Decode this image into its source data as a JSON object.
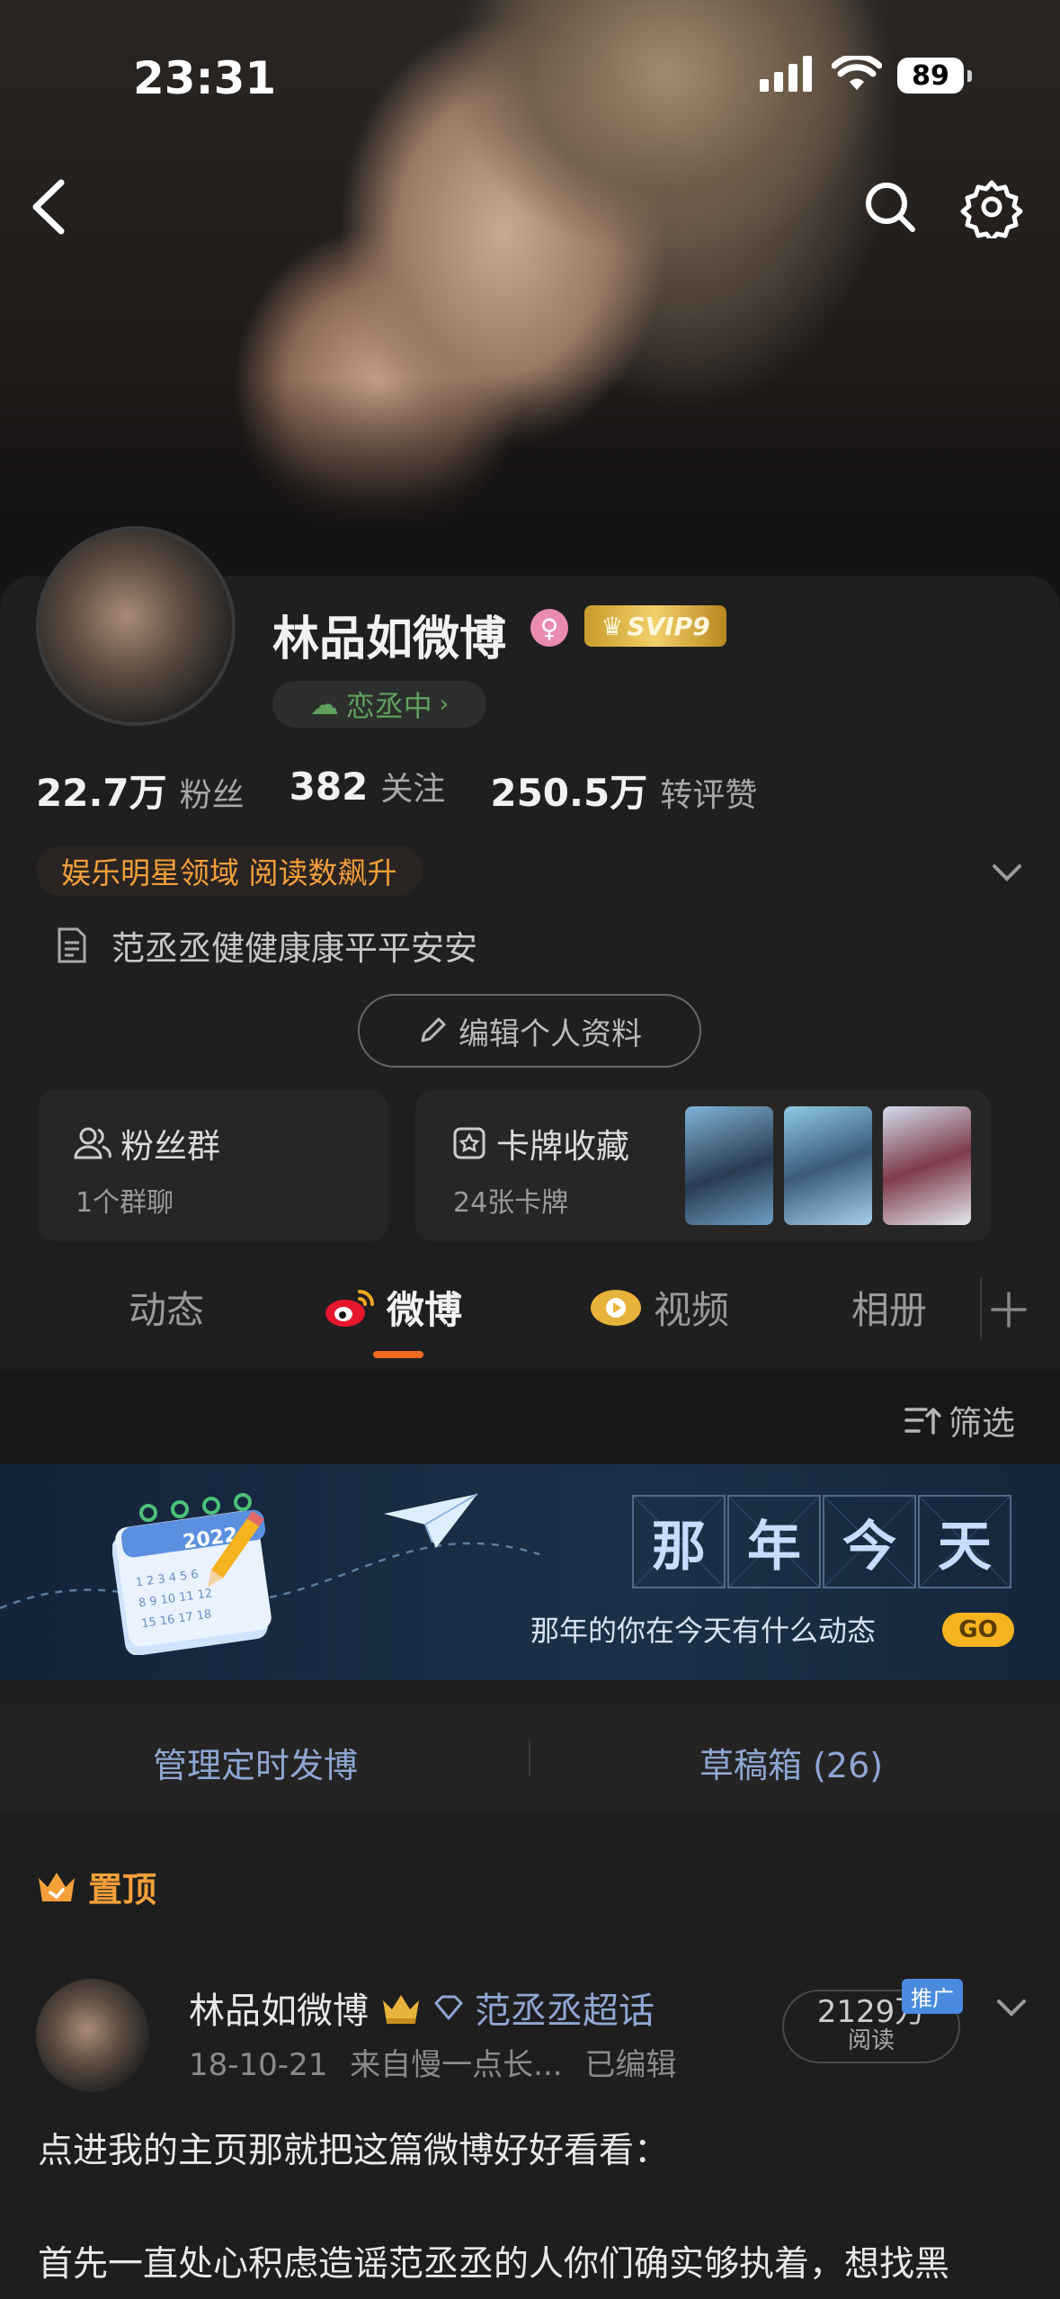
{
  "status_bar": {
    "time": "23:31",
    "battery": "89"
  },
  "profile": {
    "name": "林品如微博",
    "gender_symbol": "♀",
    "vip_badge": "SVIP9",
    "status": "恋丞中",
    "stats": [
      {
        "value": "22.7万",
        "label": "粉丝"
      },
      {
        "value": "382",
        "label": "关注"
      },
      {
        "value": "250.5万",
        "label": "转评赞"
      }
    ],
    "tag": "娱乐明星领域 阅读数飙升",
    "bio": "范丞丞健健康康平平安安",
    "edit_button": "编辑个人资料"
  },
  "cards": {
    "fan_group": {
      "title": "粉丝群",
      "subtitle": "1个群聊"
    },
    "card_collection": {
      "title": "卡牌收藏",
      "subtitle": "24张卡牌"
    }
  },
  "tabs": [
    {
      "label": "动态",
      "active": false
    },
    {
      "label": "微博",
      "active": true
    },
    {
      "label": "视频",
      "active": false
    },
    {
      "label": "相册",
      "active": false
    }
  ],
  "filter": {
    "label": "筛选"
  },
  "banner": {
    "calendar_year": "2022",
    "chars": [
      "那",
      "年",
      "今",
      "天"
    ],
    "subtitle": "那年的你在今天有什么动态",
    "go": "GO"
  },
  "manage": {
    "scheduled": "管理定时发博",
    "drafts": "草稿箱 (26)"
  },
  "pinned": {
    "label": "置顶"
  },
  "post": {
    "author": "林品如微博",
    "topic": "范丞丞超话",
    "date": "18-10-21",
    "source": "来自慢一点长...",
    "edited": "已编辑",
    "reads": "2129万",
    "reads_label": "阅读",
    "promo": "推广",
    "line1": "点进我的主页那就把这篇微博好好看看：",
    "line2": "首先一直处心积虑造谣范丞丞的人你们确实够执着，想找黑"
  }
}
